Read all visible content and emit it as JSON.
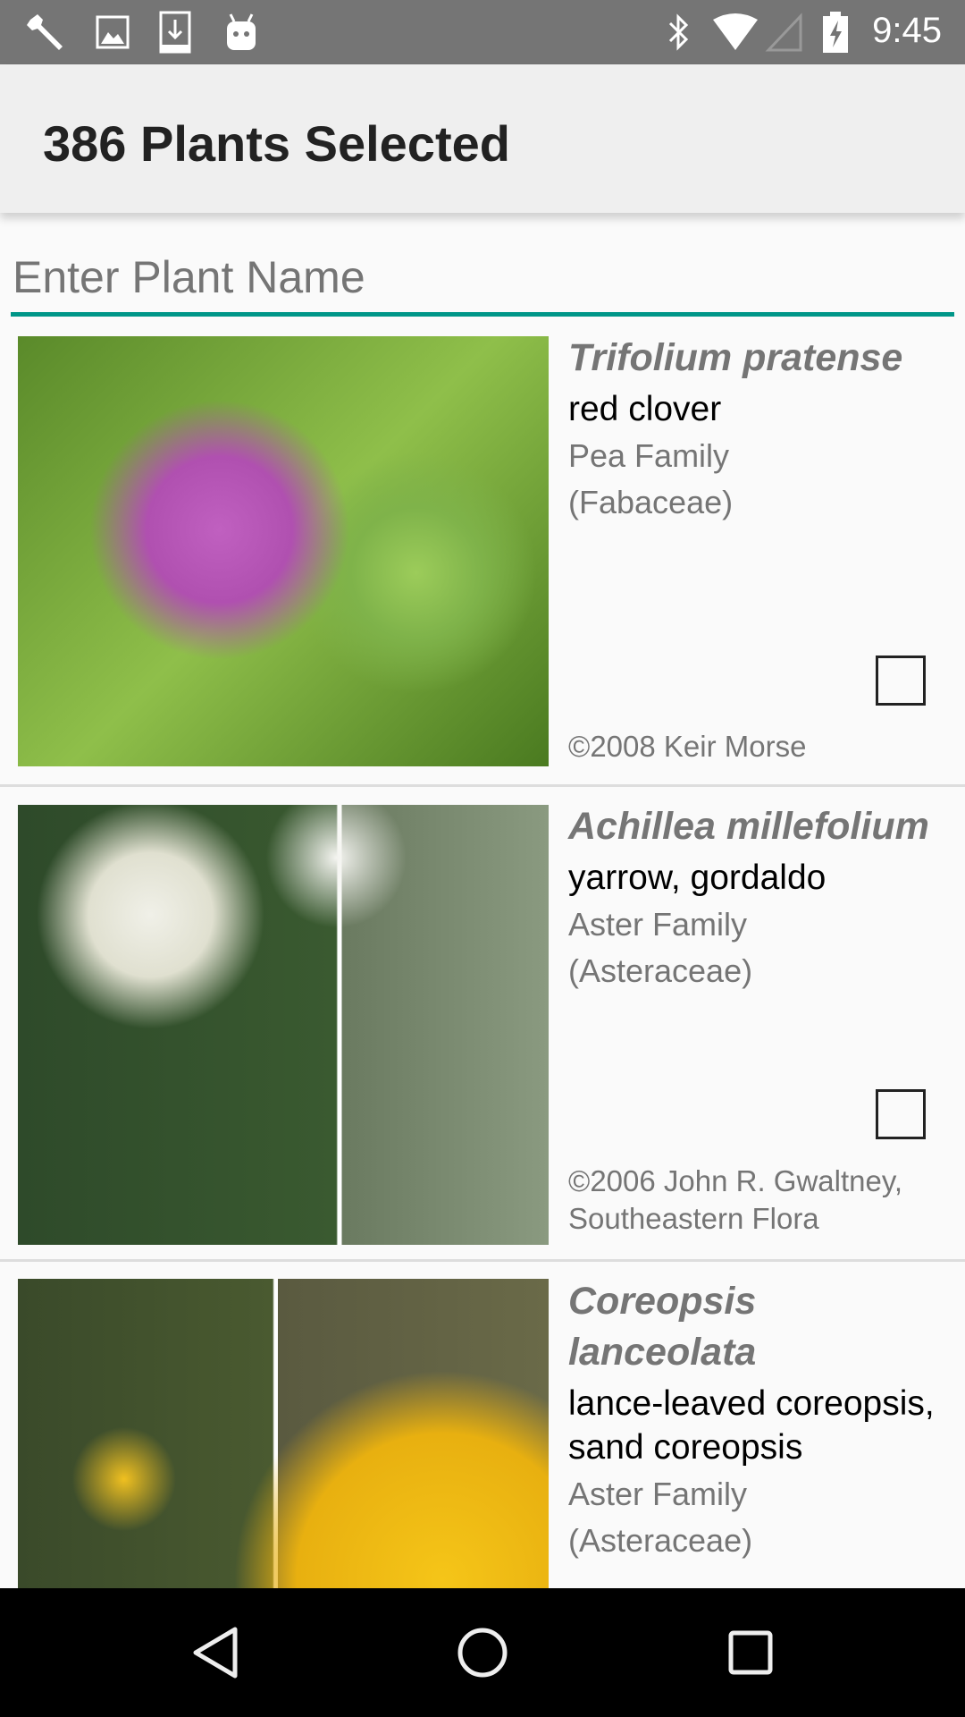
{
  "status_bar": {
    "time": "9:45",
    "left_icons": [
      "wrench-icon",
      "image-icon",
      "download-icon",
      "android-icon"
    ],
    "right_icons": [
      "bluetooth-icon",
      "wifi-icon",
      "cell-signal-icon",
      "battery-charging-icon"
    ]
  },
  "app_bar": {
    "title": "386 Plants Selected"
  },
  "search": {
    "placeholder": "Enter Plant Name",
    "value": "",
    "accent": "#009688"
  },
  "plants": [
    {
      "scientific": "Trifolium pratense",
      "common": "red clover",
      "family": "Pea Family",
      "family_latin": "(Fabaceae)",
      "credit": "©2008 Keir Morse",
      "checked": false
    },
    {
      "scientific": "Achillea millefolium",
      "common": "yarrow, gordaldo",
      "family": "Aster Family",
      "family_latin": "(Asteraceae)",
      "credit": "©2006 John R. Gwaltney, Southeastern Flora",
      "checked": false
    },
    {
      "scientific": "Coreopsis lanceolata",
      "common": "lance-leaved coreopsis, sand coreopsis",
      "family": "Aster Family",
      "family_latin": "(Asteraceae)"
    }
  ],
  "nav_bar": {
    "buttons": [
      "back-icon",
      "home-icon",
      "recents-icon"
    ]
  }
}
